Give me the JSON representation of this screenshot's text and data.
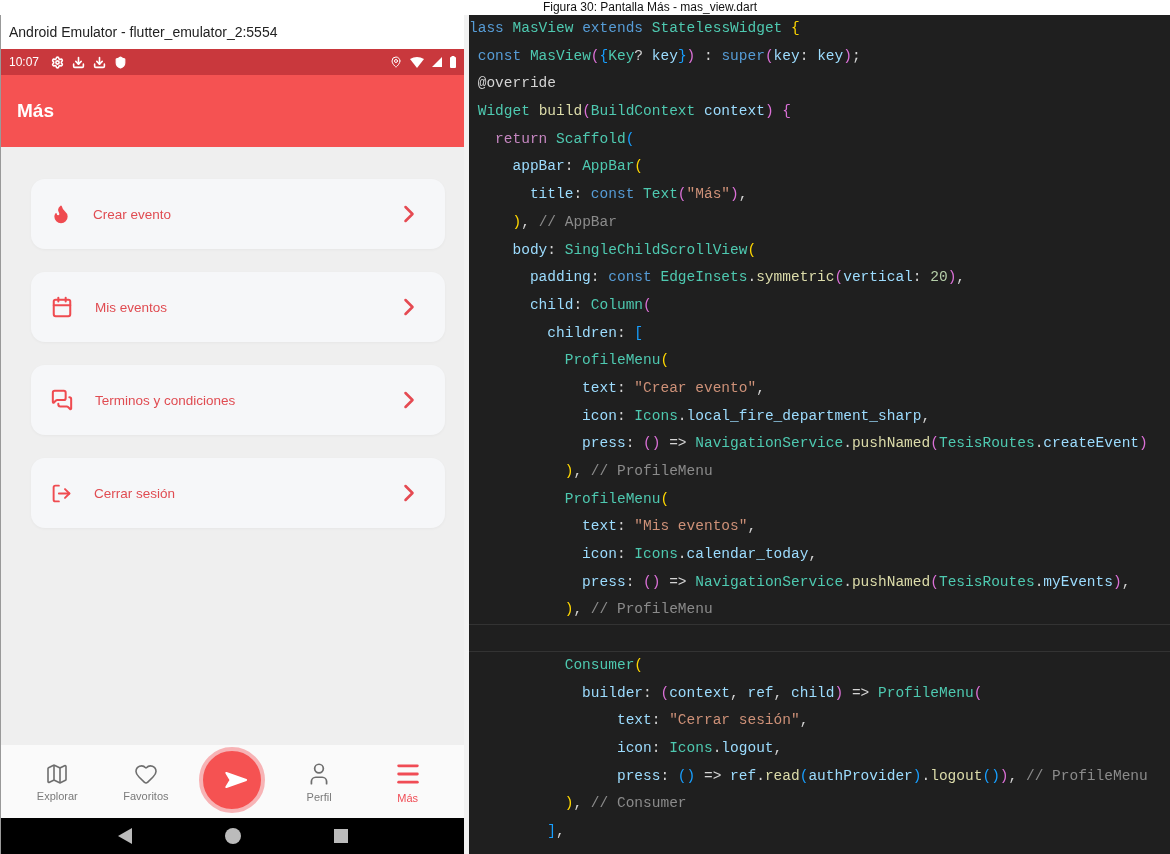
{
  "caption": "Figura 30: Pantalla Más - mas_view.dart",
  "emulator": {
    "window_title": "Android Emulator - flutter_emulator_2:5554",
    "status_bar": {
      "time": "10:07"
    },
    "app_bar": {
      "title": "Más"
    },
    "menu": [
      {
        "kind": "fire",
        "label": "Crear evento"
      },
      {
        "kind": "calendar",
        "label": "Mis eventos"
      },
      {
        "kind": "chat",
        "label": "Terminos y condiciones"
      },
      {
        "kind": "logout",
        "label": "Cerrar sesión"
      }
    ],
    "bottom_nav": [
      {
        "kind": "map",
        "label": "Explorar",
        "selected": false
      },
      {
        "kind": "heart",
        "label": "Favoritos",
        "selected": false
      },
      {
        "kind": "fab"
      },
      {
        "kind": "person",
        "label": "Perfil",
        "selected": false
      },
      {
        "kind": "menu",
        "label": "Más",
        "selected": true
      }
    ]
  },
  "editor": {
    "lines": [
      {
        "tokens": [
          {
            "kind": "kw",
            "text": "lass "
          },
          {
            "kind": "type",
            "text": "MasView "
          },
          {
            "kind": "kw",
            "text": "extends "
          },
          {
            "kind": "type",
            "text": "StatelessWidget "
          },
          {
            "kind": "b1",
            "text": "{"
          }
        ]
      },
      {
        "tokens": [
          {
            "kind": "kw",
            "text": " const "
          },
          {
            "kind": "type",
            "text": "MasView"
          },
          {
            "kind": "b2",
            "text": "("
          },
          {
            "kind": "b3",
            "text": "{"
          },
          {
            "kind": "type",
            "text": "Key"
          },
          {
            "kind": "p",
            "text": "? "
          },
          {
            "kind": "var",
            "text": "key"
          },
          {
            "kind": "b3",
            "text": "}"
          },
          {
            "kind": "b2",
            "text": ")"
          },
          {
            "kind": "p",
            "text": " : "
          },
          {
            "kind": "kw",
            "text": "super"
          },
          {
            "kind": "b2",
            "text": "("
          },
          {
            "kind": "var",
            "text": "key"
          },
          {
            "kind": "p",
            "text": ": "
          },
          {
            "kind": "var",
            "text": "key"
          },
          {
            "kind": "b2",
            "text": ")"
          },
          {
            "kind": "p",
            "text": ";"
          }
        ]
      },
      {
        "tokens": [
          {
            "kind": "p",
            "text": " @override"
          }
        ]
      },
      {
        "tokens": [
          {
            "kind": "type",
            "text": " Widget "
          },
          {
            "kind": "fn",
            "text": "build"
          },
          {
            "kind": "b2",
            "text": "("
          },
          {
            "kind": "type",
            "text": "BuildContext "
          },
          {
            "kind": "var",
            "text": "context"
          },
          {
            "kind": "b2",
            "text": ")"
          },
          {
            "kind": "b2",
            "text": " {"
          }
        ]
      },
      {
        "tokens": [
          {
            "kind": "ctl",
            "text": "   return "
          },
          {
            "kind": "type",
            "text": "Scaffold"
          },
          {
            "kind": "b3",
            "text": "("
          }
        ]
      },
      {
        "tokens": [
          {
            "kind": "var",
            "text": "     appBar"
          },
          {
            "kind": "p",
            "text": ": "
          },
          {
            "kind": "type",
            "text": "AppBar"
          },
          {
            "kind": "b1",
            "text": "("
          }
        ]
      },
      {
        "tokens": [
          {
            "kind": "var",
            "text": "       title"
          },
          {
            "kind": "p",
            "text": ": "
          },
          {
            "kind": "kw",
            "text": "const "
          },
          {
            "kind": "type",
            "text": "Text"
          },
          {
            "kind": "b2",
            "text": "("
          },
          {
            "kind": "str",
            "text": "\"Más\""
          },
          {
            "kind": "b2",
            "text": ")"
          },
          {
            "kind": "p",
            "text": ","
          }
        ]
      },
      {
        "tokens": [
          {
            "kind": "b1",
            "text": "     )"
          },
          {
            "kind": "p",
            "text": ", "
          },
          {
            "kind": "cmt",
            "text": "// AppBar"
          }
        ]
      },
      {
        "tokens": [
          {
            "kind": "var",
            "text": "     body"
          },
          {
            "kind": "p",
            "text": ": "
          },
          {
            "kind": "type",
            "text": "SingleChildScrollView"
          },
          {
            "kind": "b1",
            "text": "("
          }
        ]
      },
      {
        "tokens": [
          {
            "kind": "var",
            "text": "       padding"
          },
          {
            "kind": "p",
            "text": ": "
          },
          {
            "kind": "kw",
            "text": "const "
          },
          {
            "kind": "type",
            "text": "EdgeInsets"
          },
          {
            "kind": "p",
            "text": "."
          },
          {
            "kind": "fn",
            "text": "symmetric"
          },
          {
            "kind": "b2",
            "text": "("
          },
          {
            "kind": "var",
            "text": "vertical"
          },
          {
            "kind": "p",
            "text": ": "
          },
          {
            "kind": "num",
            "text": "20"
          },
          {
            "kind": "b2",
            "text": ")"
          },
          {
            "kind": "p",
            "text": ","
          }
        ]
      },
      {
        "tokens": [
          {
            "kind": "var",
            "text": "       child"
          },
          {
            "kind": "p",
            "text": ": "
          },
          {
            "kind": "type",
            "text": "Column"
          },
          {
            "kind": "b2",
            "text": "("
          }
        ]
      },
      {
        "tokens": [
          {
            "kind": "var",
            "text": "         children"
          },
          {
            "kind": "p",
            "text": ": "
          },
          {
            "kind": "b3",
            "text": "["
          }
        ]
      },
      {
        "tokens": [
          {
            "kind": "type",
            "text": "           ProfileMenu"
          },
          {
            "kind": "b1",
            "text": "("
          }
        ]
      },
      {
        "tokens": [
          {
            "kind": "var",
            "text": "             text"
          },
          {
            "kind": "p",
            "text": ": "
          },
          {
            "kind": "str",
            "text": "\"Crear evento\""
          },
          {
            "kind": "p",
            "text": ","
          }
        ]
      },
      {
        "tokens": [
          {
            "kind": "var",
            "text": "             icon"
          },
          {
            "kind": "p",
            "text": ": "
          },
          {
            "kind": "type",
            "text": "Icons"
          },
          {
            "kind": "p",
            "text": "."
          },
          {
            "kind": "var",
            "text": "local_fire_department_sharp"
          },
          {
            "kind": "p",
            "text": ","
          }
        ]
      },
      {
        "tokens": [
          {
            "kind": "var",
            "text": "             press"
          },
          {
            "kind": "p",
            "text": ": "
          },
          {
            "kind": "b2",
            "text": "()"
          },
          {
            "kind": "p",
            "text": " => "
          },
          {
            "kind": "type",
            "text": "NavigationService"
          },
          {
            "kind": "p",
            "text": "."
          },
          {
            "kind": "fn",
            "text": "pushNamed"
          },
          {
            "kind": "b2",
            "text": "("
          },
          {
            "kind": "type",
            "text": "TesisRoutes"
          },
          {
            "kind": "p",
            "text": "."
          },
          {
            "kind": "var",
            "text": "createEvent"
          },
          {
            "kind": "b2",
            "text": ")"
          }
        ]
      },
      {
        "tokens": [
          {
            "kind": "b1",
            "text": "           )"
          },
          {
            "kind": "p",
            "text": ", "
          },
          {
            "kind": "cmt",
            "text": "// ProfileMenu"
          }
        ]
      },
      {
        "tokens": [
          {
            "kind": "type",
            "text": "           ProfileMenu"
          },
          {
            "kind": "b1",
            "text": "("
          }
        ]
      },
      {
        "tokens": [
          {
            "kind": "var",
            "text": "             text"
          },
          {
            "kind": "p",
            "text": ": "
          },
          {
            "kind": "str",
            "text": "\"Mis eventos\""
          },
          {
            "kind": "p",
            "text": ","
          }
        ]
      },
      {
        "tokens": [
          {
            "kind": "var",
            "text": "             icon"
          },
          {
            "kind": "p",
            "text": ": "
          },
          {
            "kind": "type",
            "text": "Icons"
          },
          {
            "kind": "p",
            "text": "."
          },
          {
            "kind": "var",
            "text": "calendar_today"
          },
          {
            "kind": "p",
            "text": ","
          }
        ]
      },
      {
        "tokens": [
          {
            "kind": "var",
            "text": "             press"
          },
          {
            "kind": "p",
            "text": ": "
          },
          {
            "kind": "b2",
            "text": "()"
          },
          {
            "kind": "p",
            "text": " => "
          },
          {
            "kind": "type",
            "text": "NavigationService"
          },
          {
            "kind": "p",
            "text": "."
          },
          {
            "kind": "fn",
            "text": "pushNamed"
          },
          {
            "kind": "b2",
            "text": "("
          },
          {
            "kind": "type",
            "text": "TesisRoutes"
          },
          {
            "kind": "p",
            "text": "."
          },
          {
            "kind": "var",
            "text": "myEvents"
          },
          {
            "kind": "b2",
            "text": ")"
          },
          {
            "kind": "p",
            "text": ","
          }
        ]
      },
      {
        "tokens": [
          {
            "kind": "b1",
            "text": "           )"
          },
          {
            "kind": "p",
            "text": ", "
          },
          {
            "kind": "cmt",
            "text": "// ProfileMenu"
          }
        ]
      },
      {
        "kind": "cursor"
      },
      {
        "tokens": [
          {
            "kind": "type",
            "text": "           Consumer"
          },
          {
            "kind": "b1",
            "text": "("
          }
        ]
      },
      {
        "tokens": [
          {
            "kind": "var",
            "text": "             builder"
          },
          {
            "kind": "p",
            "text": ": "
          },
          {
            "kind": "b2",
            "text": "("
          },
          {
            "kind": "var",
            "text": "context"
          },
          {
            "kind": "p",
            "text": ", "
          },
          {
            "kind": "var",
            "text": "ref"
          },
          {
            "kind": "p",
            "text": ", "
          },
          {
            "kind": "var",
            "text": "child"
          },
          {
            "kind": "b2",
            "text": ")"
          },
          {
            "kind": "p",
            "text": " => "
          },
          {
            "kind": "type",
            "text": "ProfileMenu"
          },
          {
            "kind": "b2",
            "text": "("
          }
        ]
      },
      {
        "tokens": [
          {
            "kind": "var",
            "text": "                 text"
          },
          {
            "kind": "p",
            "text": ": "
          },
          {
            "kind": "str",
            "text": "\"Cerrar sesión\""
          },
          {
            "kind": "p",
            "text": ","
          }
        ]
      },
      {
        "tokens": [
          {
            "kind": "var",
            "text": "                 icon"
          },
          {
            "kind": "p",
            "text": ": "
          },
          {
            "kind": "type",
            "text": "Icons"
          },
          {
            "kind": "p",
            "text": "."
          },
          {
            "kind": "var",
            "text": "logout"
          },
          {
            "kind": "p",
            "text": ","
          }
        ]
      },
      {
        "tokens": [
          {
            "kind": "var",
            "text": "                 press"
          },
          {
            "kind": "p",
            "text": ": "
          },
          {
            "kind": "b3",
            "text": "()"
          },
          {
            "kind": "p",
            "text": " => "
          },
          {
            "kind": "var",
            "text": "ref"
          },
          {
            "kind": "p",
            "text": "."
          },
          {
            "kind": "fn",
            "text": "read"
          },
          {
            "kind": "b3",
            "text": "("
          },
          {
            "kind": "var",
            "text": "authProvider"
          },
          {
            "kind": "b3",
            "text": ")"
          },
          {
            "kind": "p",
            "text": "."
          },
          {
            "kind": "fn",
            "text": "logout"
          },
          {
            "kind": "b3",
            "text": "()"
          },
          {
            "kind": "b2",
            "text": ")"
          },
          {
            "kind": "p",
            "text": ", "
          },
          {
            "kind": "cmt",
            "text": "// ProfileMenu"
          }
        ]
      },
      {
        "tokens": [
          {
            "kind": "b1",
            "text": "           )"
          },
          {
            "kind": "p",
            "text": ", "
          },
          {
            "kind": "cmt",
            "text": "// Consumer"
          }
        ]
      },
      {
        "tokens": [
          {
            "kind": "b3",
            "text": "         ]"
          },
          {
            "kind": "p",
            "text": ","
          }
        ]
      }
    ]
  }
}
